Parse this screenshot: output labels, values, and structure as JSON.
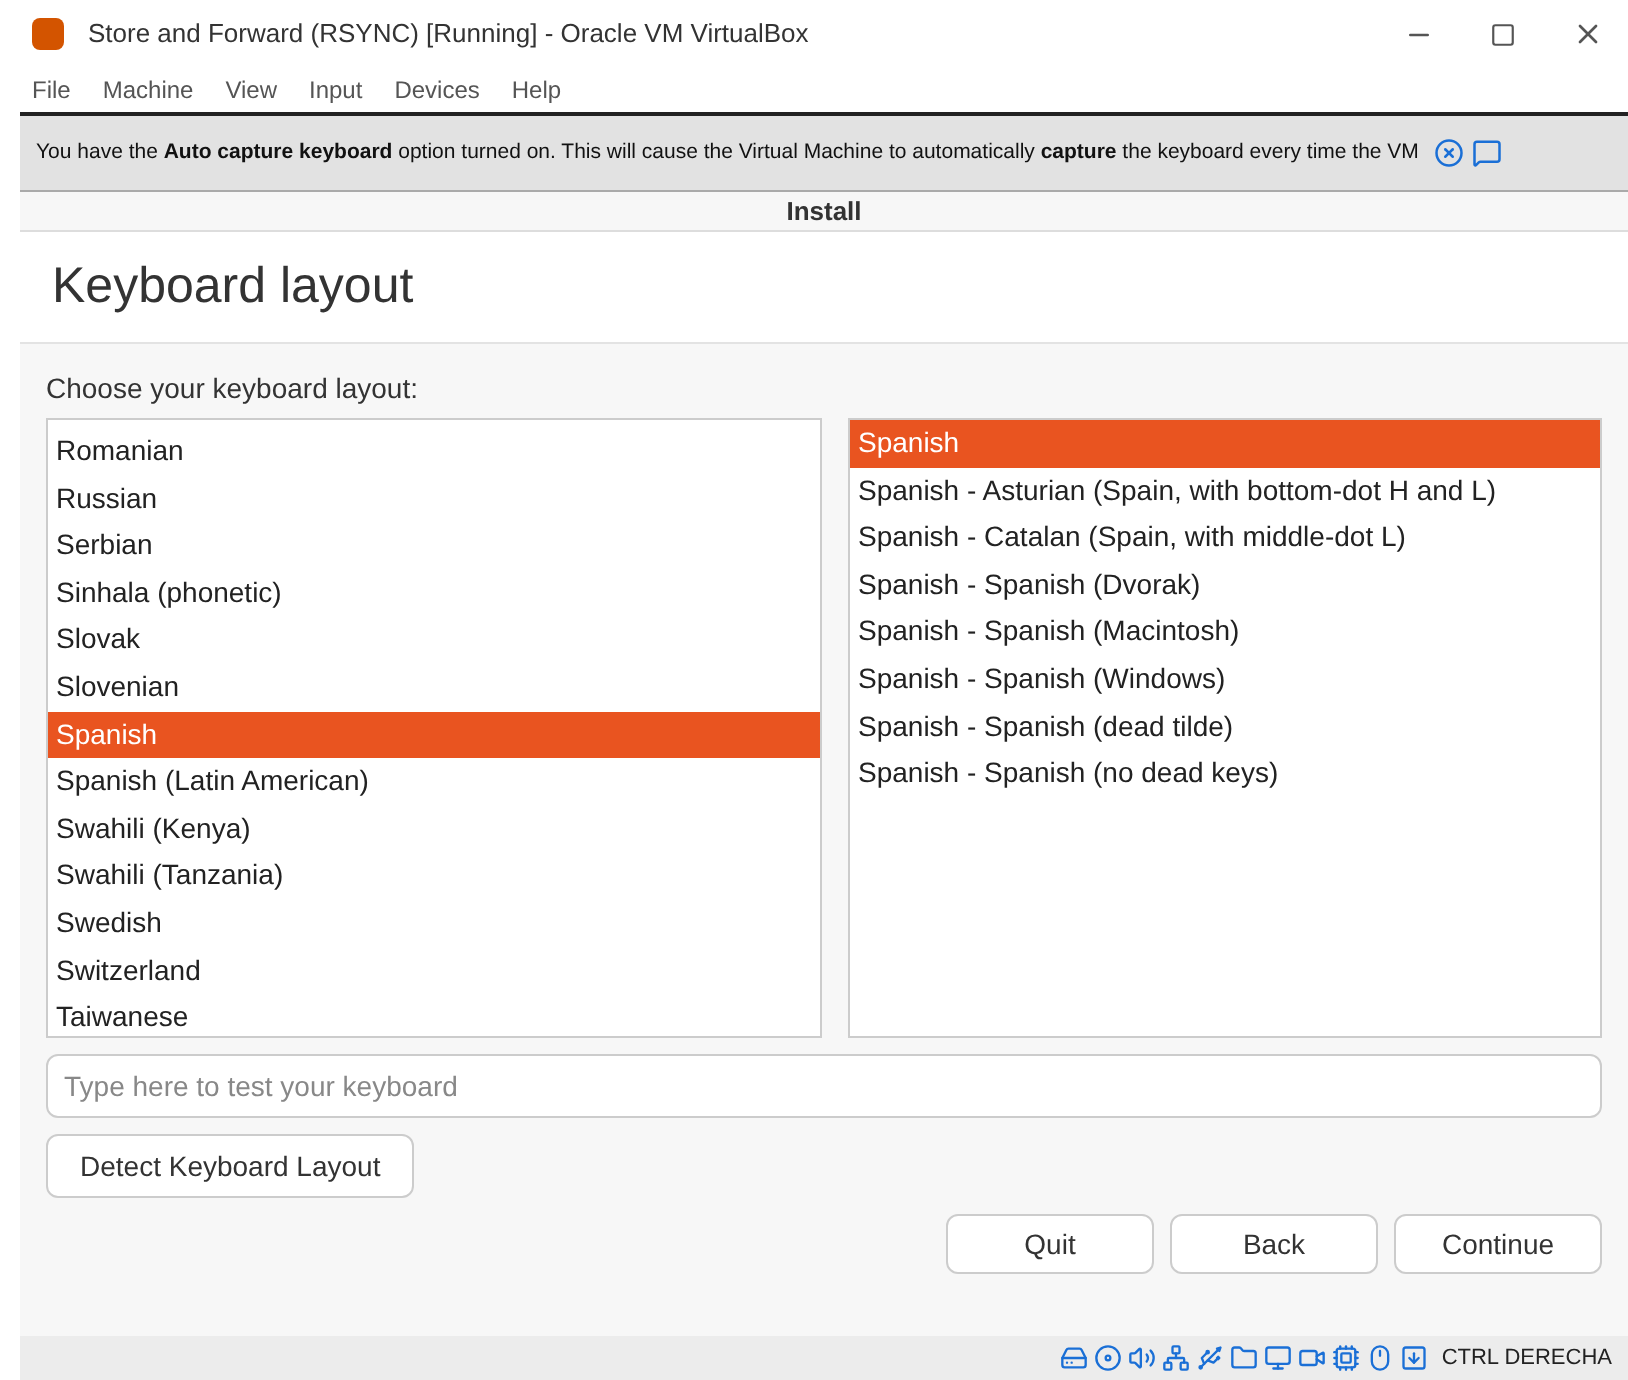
{
  "window": {
    "title": "Store and Forward (RSYNC) [Running] - Oracle VM VirtualBox"
  },
  "menu": [
    "File",
    "Machine",
    "View",
    "Input",
    "Devices",
    "Help"
  ],
  "notification": {
    "text": "You have the **Auto capture keyboard** option turned on. This will cause the Virtual Machine to automatically **capture** the keyboard every time the VM"
  },
  "installer": {
    "title": "Install",
    "heading": "Keyboard layout",
    "prompt": "Choose your keyboard layout:",
    "layouts": [
      {
        "label": "Romanian",
        "selected": false
      },
      {
        "label": "Russian",
        "selected": false
      },
      {
        "label": "Serbian",
        "selected": false
      },
      {
        "label": "Sinhala (phonetic)",
        "selected": false
      },
      {
        "label": "Slovak",
        "selected": false
      },
      {
        "label": "Slovenian",
        "selected": false
      },
      {
        "label": "Spanish",
        "selected": true
      },
      {
        "label": "Spanish (Latin American)",
        "selected": false
      },
      {
        "label": "Swahili (Kenya)",
        "selected": false
      },
      {
        "label": "Swahili (Tanzania)",
        "selected": false
      },
      {
        "label": "Swedish",
        "selected": false
      },
      {
        "label": "Switzerland",
        "selected": false
      },
      {
        "label": "Taiwanese",
        "selected": false
      }
    ],
    "variants": [
      {
        "label": "Spanish",
        "selected": true
      },
      {
        "label": "Spanish - Asturian (Spain, with bottom-dot H and L)",
        "selected": false
      },
      {
        "label": "Spanish - Catalan (Spain, with middle-dot L)",
        "selected": false
      },
      {
        "label": "Spanish - Spanish (Dvorak)",
        "selected": false
      },
      {
        "label": "Spanish - Spanish (Macintosh)",
        "selected": false
      },
      {
        "label": "Spanish - Spanish (Windows)",
        "selected": false
      },
      {
        "label": "Spanish - Spanish (dead tilde)",
        "selected": false
      },
      {
        "label": "Spanish - Spanish (no dead keys)",
        "selected": false
      }
    ],
    "test_field": {
      "placeholder": "Type here to test your keyboard"
    },
    "detect_button": "Detect Keyboard Layout",
    "buttons": [
      "Quit",
      "Back",
      "Continue"
    ]
  },
  "status_bar": {
    "host_key": "CTRL DERECHA"
  }
}
